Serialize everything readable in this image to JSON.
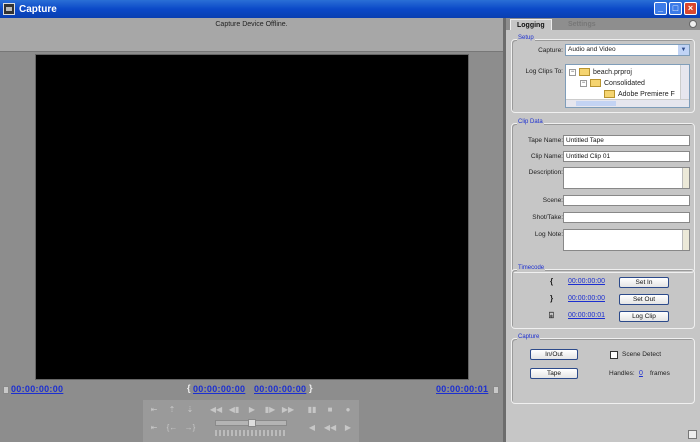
{
  "window": {
    "title": "Capture",
    "controls": [
      "_",
      "□",
      "×"
    ]
  },
  "monitor": {
    "status": "Capture Device Offline.",
    "current_time": "00:00:00:00",
    "in_point": "00:00:00:00",
    "out_point": "00:00:00:00",
    "duration": "00:00:00:01"
  },
  "transport": {
    "row1": [
      "⇤",
      "⇡",
      "⇣",
      "◀◀",
      "◀▮",
      "▶",
      "▮▶",
      "▶▶",
      "▮▮",
      "■",
      "●"
    ],
    "row2": [
      "⇤",
      "{←",
      "→}",
      "◀",
      "◀◀",
      "▶▶",
      "▶"
    ]
  },
  "panel": {
    "tabs": [
      "Logging",
      "Settings"
    ],
    "setup": {
      "title": "Setup",
      "capture_label": "Capture:",
      "capture_value": "Audio and Video",
      "log_clips_label": "Log Clips To:",
      "tree": [
        "beach.prproj",
        "Consolidated",
        "Adobe Premiere F"
      ]
    },
    "clip_data": {
      "title": "Clip Data",
      "tape_name_label": "Tape Name:",
      "tape_name": "Untitled Tape",
      "clip_name_label": "Clip Name:",
      "clip_name": "Untitled Clip 01",
      "description_label": "Description:",
      "description": "",
      "scene_label": "Scene:",
      "scene": "",
      "shot_take_label": "Shot/Take:",
      "shot_take": "",
      "log_note_label": "Log Note:",
      "log_note": ""
    },
    "timecode": {
      "title": "Timecode",
      "in": "00:00:00:00",
      "out": "00:00:00:00",
      "duration": "00:00:00:01",
      "set_in": "Set In",
      "set_out": "Set Out",
      "log_clip": "Log Clip"
    },
    "capture": {
      "title": "Capture",
      "in_out": "In/Out",
      "tape": "Tape",
      "scene_detect": "Scene Detect",
      "handles_label": "Handles:",
      "handles_value": "0",
      "frames_label": "frames"
    }
  }
}
